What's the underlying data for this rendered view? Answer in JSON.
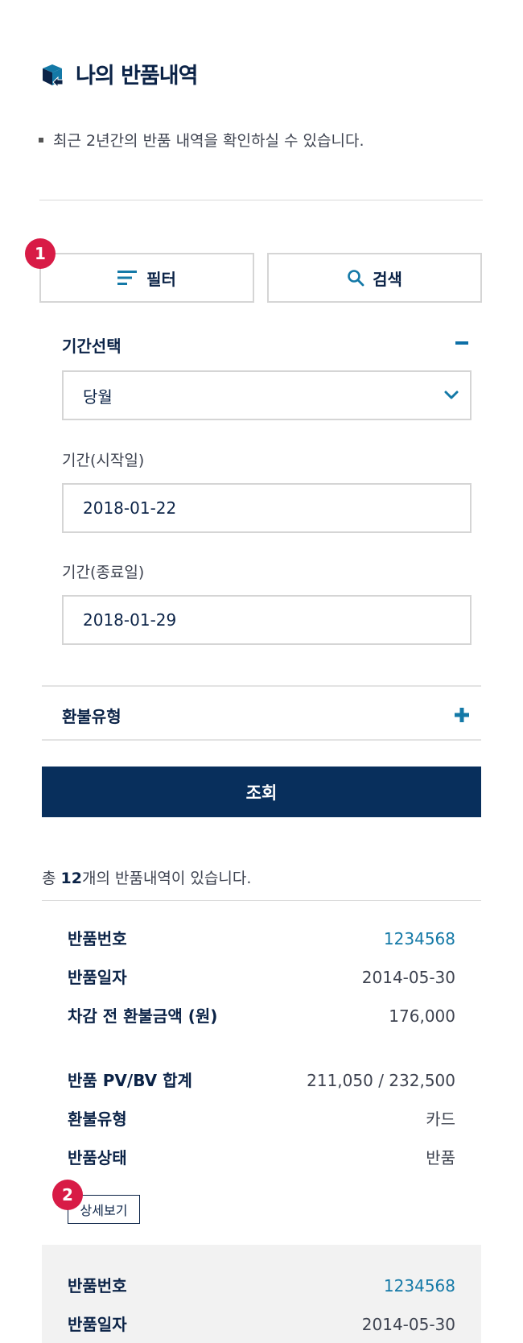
{
  "header": {
    "title": "나의 반품내역",
    "icon": "return-box-icon",
    "notice": "최근 2년간의 반품 내역을 확인하실 수 있습니다."
  },
  "actions": {
    "filter_label": "필터",
    "search_label": "검색",
    "badge_1": "1",
    "badge_2": "2"
  },
  "filter": {
    "period_label": "기간선택",
    "period_value": "당월",
    "start_label": "기간(시작일)",
    "start_value": "2018-01-22",
    "end_label": "기간(종료일)",
    "end_value": "2018-01-29",
    "refund_type_label": "환불유형",
    "query_label": "조회"
  },
  "summary": {
    "prefix": "총 ",
    "count": "12",
    "suffix": "개의 반품내역이 있습니다."
  },
  "records": [
    {
      "return_no_label": "반품번호",
      "return_no": "1234568",
      "return_date_label": "반품일자",
      "return_date": "2014-05-30",
      "refund_before_label": "차감 전 환불금액 (원)",
      "refund_before": "176,000",
      "pvbv_label": "반품 PV/BV 합계",
      "pvbv": "211,050 / 232,500",
      "refund_type_label": "환불유형",
      "refund_type": "카드",
      "status_label": "반품상태",
      "status": "반품",
      "detail_label": "상세보기"
    },
    {
      "return_no_label": "반품번호",
      "return_no": "1234568",
      "return_date_label": "반품일자",
      "return_date": "2014-05-30"
    }
  ],
  "colors": {
    "navy": "#082f5c",
    "accent_blue": "#1479a7",
    "badge_red": "#d81b46"
  }
}
